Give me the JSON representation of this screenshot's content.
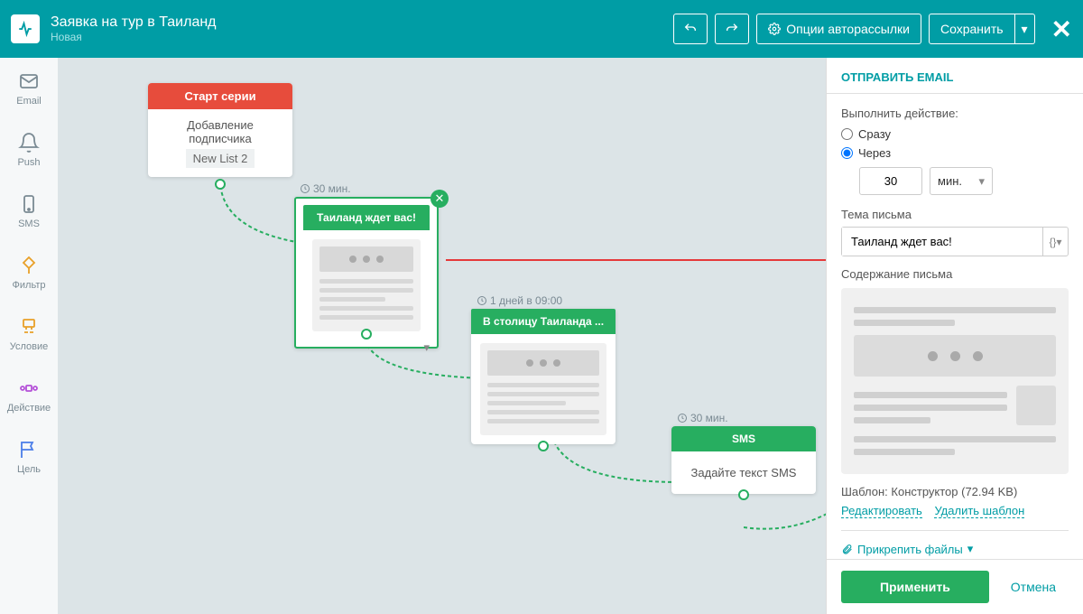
{
  "header": {
    "title": "Заявка на тур в Таиланд",
    "status": "Новая",
    "autoresponder": "Опции авторассылки",
    "save": "Сохранить"
  },
  "sidebar": [
    {
      "label": "Email"
    },
    {
      "label": "Push"
    },
    {
      "label": "SMS"
    },
    {
      "label": "Фильтр"
    },
    {
      "label": "Условие"
    },
    {
      "label": "Действие"
    },
    {
      "label": "Цель"
    }
  ],
  "nodes": {
    "start": {
      "title": "Старт серии",
      "desc": "Добавление подписчика",
      "list": "New List 2"
    },
    "email1": {
      "title": "Таиланд ждет вас!",
      "delay": "30 мин."
    },
    "email2": {
      "title": "В столицу Таиланда ...",
      "delay": "1 дней в 09:00"
    },
    "sms": {
      "title": "SMS",
      "desc": "Задайте текст SMS",
      "delay": "30 мин."
    }
  },
  "panel": {
    "title": "ОТПРАВИТЬ EMAIL",
    "action_label": "Выполнить действие:",
    "opt_now": "Сразу",
    "opt_delay": "Через",
    "delay_value": "30",
    "delay_unit": "мин.",
    "subject_label": "Тема письма",
    "subject_value": "Таиланд ждет вас!",
    "content_label": "Содержание письма",
    "template_label": "Шаблон:",
    "template_name": "Конструктор (72.94 KB)",
    "edit": "Редактировать",
    "delete": "Удалить шаблон",
    "attach": "Прикрепить файлы",
    "apply": "Применить",
    "cancel": "Отмена"
  }
}
